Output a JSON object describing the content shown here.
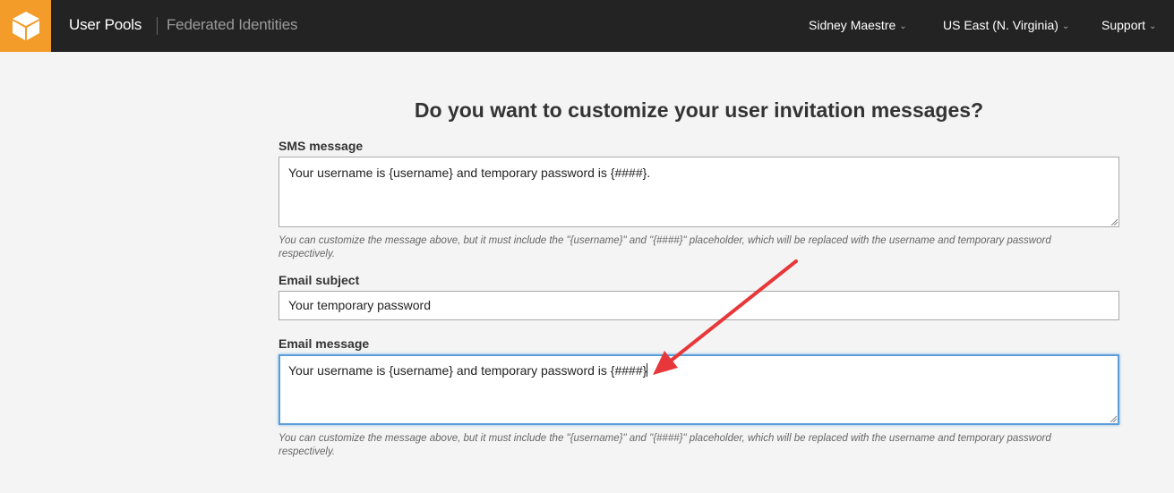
{
  "header": {
    "user_pools": "User Pools",
    "federated_identities": "Federated Identities",
    "user_menu": "Sidney Maestre",
    "region_menu": "US East (N. Virginia)",
    "support_menu": "Support",
    "logo_icon": "aws-cube-icon",
    "logo_color": "#f39c2a"
  },
  "main": {
    "title": "Do you want to customize your user invitation messages?",
    "sms": {
      "label": "SMS message",
      "value": "Your username is {username} and temporary password is {####}.",
      "hint": "You can customize the message above, but it must include the \"{username}\" and \"{####}\" placeholder, which will be replaced with the username and temporary password respectively."
    },
    "email_subject": {
      "label": "Email subject",
      "value": "Your temporary password"
    },
    "email_message": {
      "label": "Email message",
      "value": "Your username is {username} and temporary password is {####}",
      "hint": "You can customize the message above, but it must include the \"{username}\" and \"{####}\" placeholder, which will be replaced with the username and temporary password respectively."
    }
  },
  "annotation": {
    "arrow_color": "#e8373a"
  }
}
